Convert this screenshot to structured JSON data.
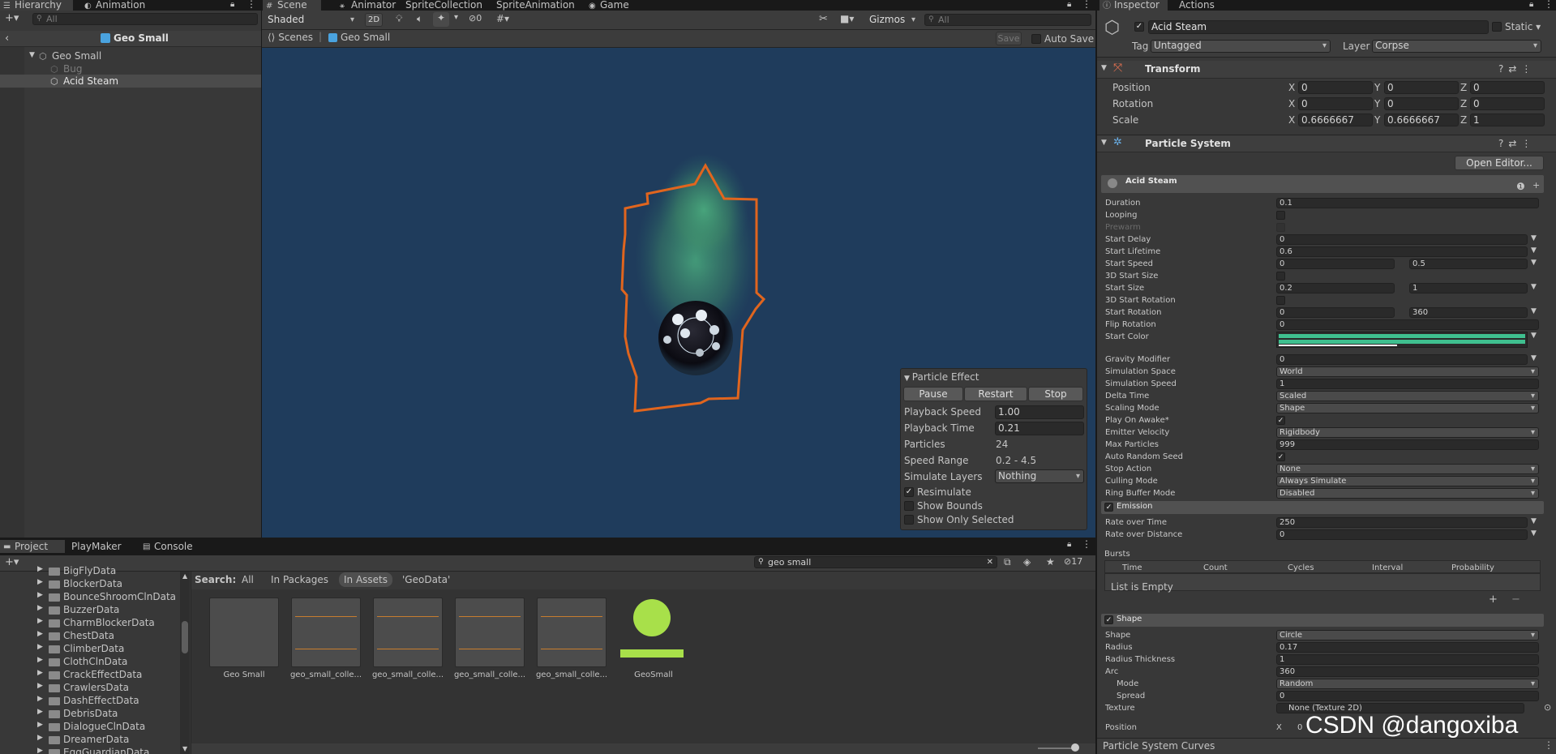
{
  "hierarchy": {
    "tab_label": "Hierarchy",
    "animation_tab": "Animation",
    "search_placeholder": "All",
    "scene_name": "Geo Small",
    "items": [
      "Geo Small",
      "Bug",
      "Acid Steam"
    ]
  },
  "scene_tabs": {
    "scene": "Scene",
    "animator": "Animator",
    "sprite_collection": "SpriteCollection",
    "sprite_animation": "SpriteAnimation",
    "game": "Game"
  },
  "scene_toolbar": {
    "shading": "Shaded",
    "mode_2d": "2D",
    "hidden_count": "0",
    "gizmos": "Gizmos",
    "search_placeholder": "All"
  },
  "scene_breadcrumb": {
    "scenes": "Scenes",
    "current": "Geo Small",
    "save": "Save",
    "auto_save": "Auto Save"
  },
  "particle_effect": {
    "title": "Particle Effect",
    "pause": "Pause",
    "restart": "Restart",
    "stop": "Stop",
    "rows": [
      {
        "label": "Playback Speed",
        "value": "1.00"
      },
      {
        "label": "Playback Time",
        "value": "0.21"
      },
      {
        "label": "Particles",
        "value": "24"
      },
      {
        "label": "Speed Range",
        "value": "0.2 - 4.5"
      },
      {
        "label": "Simulate Layers",
        "value": "Nothing"
      }
    ],
    "checks": [
      {
        "label": "Resimulate",
        "checked": "✓"
      },
      {
        "label": "Show Bounds",
        "checked": ""
      },
      {
        "label": "Show Only Selected",
        "checked": ""
      }
    ]
  },
  "project": {
    "tabs": [
      "Project",
      "PlayMaker",
      "Console"
    ],
    "search_value": "geo small",
    "hidden_count": "17",
    "search_label": "Search:",
    "filters": [
      "All",
      "In Packages",
      "In Assets",
      "'GeoData'"
    ],
    "folders": [
      "BigFlyData",
      "BlockerData",
      "BounceShroomClnData",
      "BuzzerData",
      "CharmBlockerData",
      "ChestData",
      "ClimberData",
      "ClothClnData",
      "CrackEffectData",
      "CrawlersData",
      "DashEffectData",
      "DebrisData",
      "DialogueClnData",
      "DreamerData",
      "EggGuardianData"
    ],
    "assets": [
      "Geo Small",
      "geo_small_colle...",
      "geo_small_colle...",
      "geo_small_colle...",
      "geo_small_colle...",
      "GeoSmall"
    ]
  },
  "inspector": {
    "tabs": [
      "Inspector",
      "Actions"
    ],
    "object_name": "Acid Steam",
    "static": "Static",
    "tag_label": "Tag",
    "tag": "Untagged",
    "layer_label": "Layer",
    "layer": "Corpse",
    "transform": {
      "title": "Transform",
      "rows": [
        {
          "label": "Position",
          "x": "0",
          "y": "0",
          "z": "0"
        },
        {
          "label": "Rotation",
          "x": "0",
          "y": "0",
          "z": "0"
        },
        {
          "label": "Scale",
          "x": "0.6666667",
          "y": "0.6666667",
          "z": "1"
        }
      ]
    },
    "particle_system": {
      "title": "Particle System",
      "open_editor": "Open Editor...",
      "sub_title": "Acid Steam",
      "props": [
        {
          "label": "Duration",
          "value": "0.1",
          "kind": "field"
        },
        {
          "label": "Looping",
          "value": "",
          "kind": "check"
        },
        {
          "label": "Prewarm",
          "value": "",
          "kind": "check-dim"
        },
        {
          "label": "Start Delay",
          "value": "0",
          "kind": "field-dd"
        },
        {
          "label": "Start Lifetime",
          "value": "0.6",
          "kind": "field-dd"
        },
        {
          "label": "Start Speed",
          "value": "0",
          "value2": "0.5",
          "kind": "two"
        },
        {
          "label": "3D Start Size",
          "value": "",
          "kind": "check"
        },
        {
          "label": "Start Size",
          "value": "0.2",
          "value2": "1",
          "kind": "two"
        },
        {
          "label": "3D Start Rotation",
          "value": "",
          "kind": "check"
        },
        {
          "label": "Start Rotation",
          "value": "0",
          "value2": "360",
          "kind": "two"
        },
        {
          "label": "Flip Rotation",
          "value": "0",
          "kind": "field"
        },
        {
          "label": "Start Color",
          "value": "",
          "kind": "color"
        },
        {
          "label": "Gravity Modifier",
          "value": "0",
          "kind": "field-dd"
        },
        {
          "label": "Simulation Space",
          "value": "World",
          "kind": "dropdown"
        },
        {
          "label": "Simulation Speed",
          "value": "1",
          "kind": "field"
        },
        {
          "label": "Delta Time",
          "value": "Scaled",
          "kind": "dropdown"
        },
        {
          "label": "Scaling Mode",
          "value": "Shape",
          "kind": "dropdown"
        },
        {
          "label": "Play On Awake*",
          "value": "✓",
          "kind": "check"
        },
        {
          "label": "Emitter Velocity",
          "value": "Rigidbody",
          "kind": "dropdown"
        },
        {
          "label": "Max Particles",
          "value": "999",
          "kind": "field"
        },
        {
          "label": "Auto Random Seed",
          "value": "✓",
          "kind": "check"
        },
        {
          "label": "Stop Action",
          "value": "None",
          "kind": "dropdown"
        },
        {
          "label": "Culling Mode",
          "value": "Always Simulate",
          "kind": "dropdown"
        },
        {
          "label": "Ring Buffer Mode",
          "value": "Disabled",
          "kind": "dropdown"
        }
      ],
      "emission": {
        "title": "Emission",
        "rate_over_time_label": "Rate over Time",
        "rate_over_time": "250",
        "rate_over_distance_label": "Rate over Distance",
        "rate_over_distance": "0",
        "bursts": "Bursts",
        "columns": [
          "Time",
          "Count",
          "Cycles",
          "Interval",
          "Probability"
        ],
        "empty": "List is Empty",
        "add": "+",
        "remove": "−"
      },
      "shape": {
        "title": "Shape",
        "rows": [
          {
            "label": "Shape",
            "value": "Circle",
            "kind": "dropdown"
          },
          {
            "label": "Radius",
            "value": "0.17",
            "kind": "field"
          },
          {
            "label": "Radius Thickness",
            "value": "1",
            "kind": "field"
          },
          {
            "label": "Arc",
            "value": "360",
            "kind": "field"
          },
          {
            "label": "Mode",
            "value": "Random",
            "kind": "dropdown"
          },
          {
            "label": "Spread",
            "value": "0",
            "kind": "field"
          },
          {
            "label": "Texture",
            "value": "None (Texture 2D)",
            "kind": "field"
          }
        ],
        "position_label": "Position"
      },
      "curves_title": "Particle System Curves"
    }
  },
  "watermark": "CSDN @dangoxiba",
  "colors": {
    "scene_bg": "#1f3c5c",
    "selection_outline": "#e0651e",
    "steam_green": "#4caf80",
    "start_color": "#3fbf8f",
    "geo_green": "#a8e04a"
  }
}
